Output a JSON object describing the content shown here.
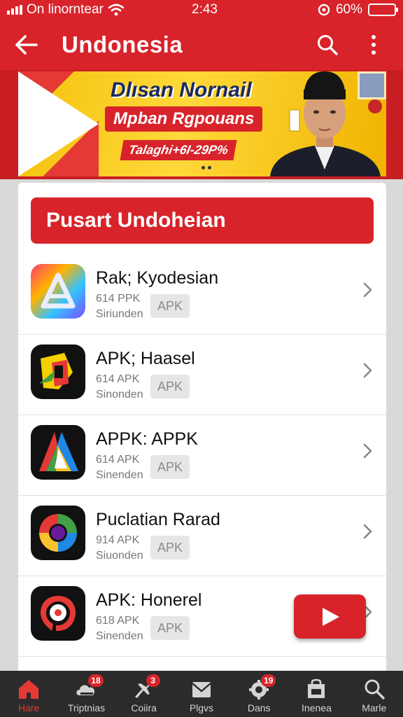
{
  "status_bar": {
    "carrier": "On linorntear",
    "time": "2:43",
    "battery": "60%",
    "battery_level": 0.6
  },
  "app_bar": {
    "title": "Undonesia",
    "back_icon": "arrow-left-icon",
    "search_icon": "search-icon",
    "menu_icon": "more-vertical-icon"
  },
  "banner": {
    "headline": "Dlısan Nornail",
    "subheadline": "Mpban Rgpouans",
    "tagline": "Talaghi+6I-29P%"
  },
  "section": {
    "title": "Pusart Undoheian"
  },
  "apps": [
    {
      "name": "Rak; Kyodesian",
      "size": "614 PPK",
      "category": "Siriunden",
      "badge": "APK"
    },
    {
      "name": "APK; Haasel",
      "size": "614 APK",
      "category": "Sinonden",
      "badge": "APK"
    },
    {
      "name": "APPK: APPK",
      "size": "614 APK",
      "category": "Sinenden",
      "badge": "APK"
    },
    {
      "name": "Puclatian Rarad",
      "size": "914 APK",
      "category": "Siuonden",
      "badge": "APK"
    },
    {
      "name": "APK: Honerel",
      "size": "618 APK",
      "category": "Sinenden",
      "badge": "APK"
    }
  ],
  "bottom_nav": [
    {
      "label": "Hare",
      "icon": "home-icon",
      "badge": ""
    },
    {
      "label": "Triptnias",
      "icon": "cloud-icon",
      "badge": "18"
    },
    {
      "label": "Coiira",
      "icon": "plane-icon",
      "badge": "3"
    },
    {
      "label": "Plgvs",
      "icon": "mail-icon",
      "badge": ""
    },
    {
      "label": "Dans",
      "icon": "gear-icon",
      "badge": "19"
    },
    {
      "label": "Inenea",
      "icon": "store-icon",
      "badge": ""
    },
    {
      "label": "Marle",
      "icon": "search-icon",
      "badge": ""
    }
  ],
  "colors": {
    "primary": "#d8232a",
    "nav_bg": "#2b2b2b",
    "banner_yellow": "#f4c20d"
  }
}
